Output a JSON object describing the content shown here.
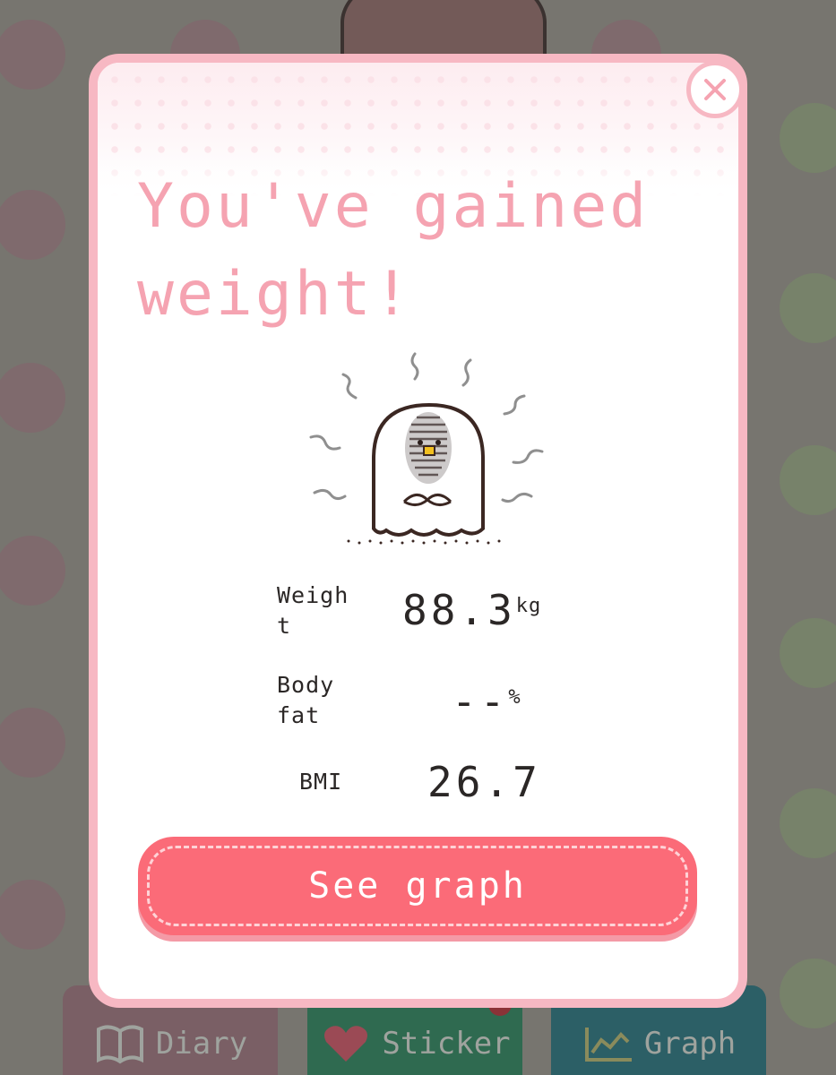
{
  "dialog": {
    "title": "You've gained weight!",
    "close_icon": "close-icon",
    "mascot": "nervous-ghost-mascot",
    "stats": {
      "weight_label": "Weigh t",
      "weight_value": "88.3",
      "weight_unit": "kg",
      "bodyfat_label": "Body fat",
      "bodyfat_value": "--",
      "bodyfat_unit": "%",
      "bmi_label": "BMI",
      "bmi_value": "26.7"
    },
    "see_graph_label": "See graph"
  },
  "tabs": {
    "diary": {
      "label": "Diary",
      "icon": "book-icon"
    },
    "sticker": {
      "label": "Sticker",
      "icon": "heart-icon"
    },
    "graph": {
      "label": "Graph",
      "icon": "chart-icon"
    }
  },
  "colors": {
    "accent": "#fb6b78",
    "title": "#f5a3b1",
    "frame": "#f7b8c3",
    "overlay": "#77756f"
  }
}
